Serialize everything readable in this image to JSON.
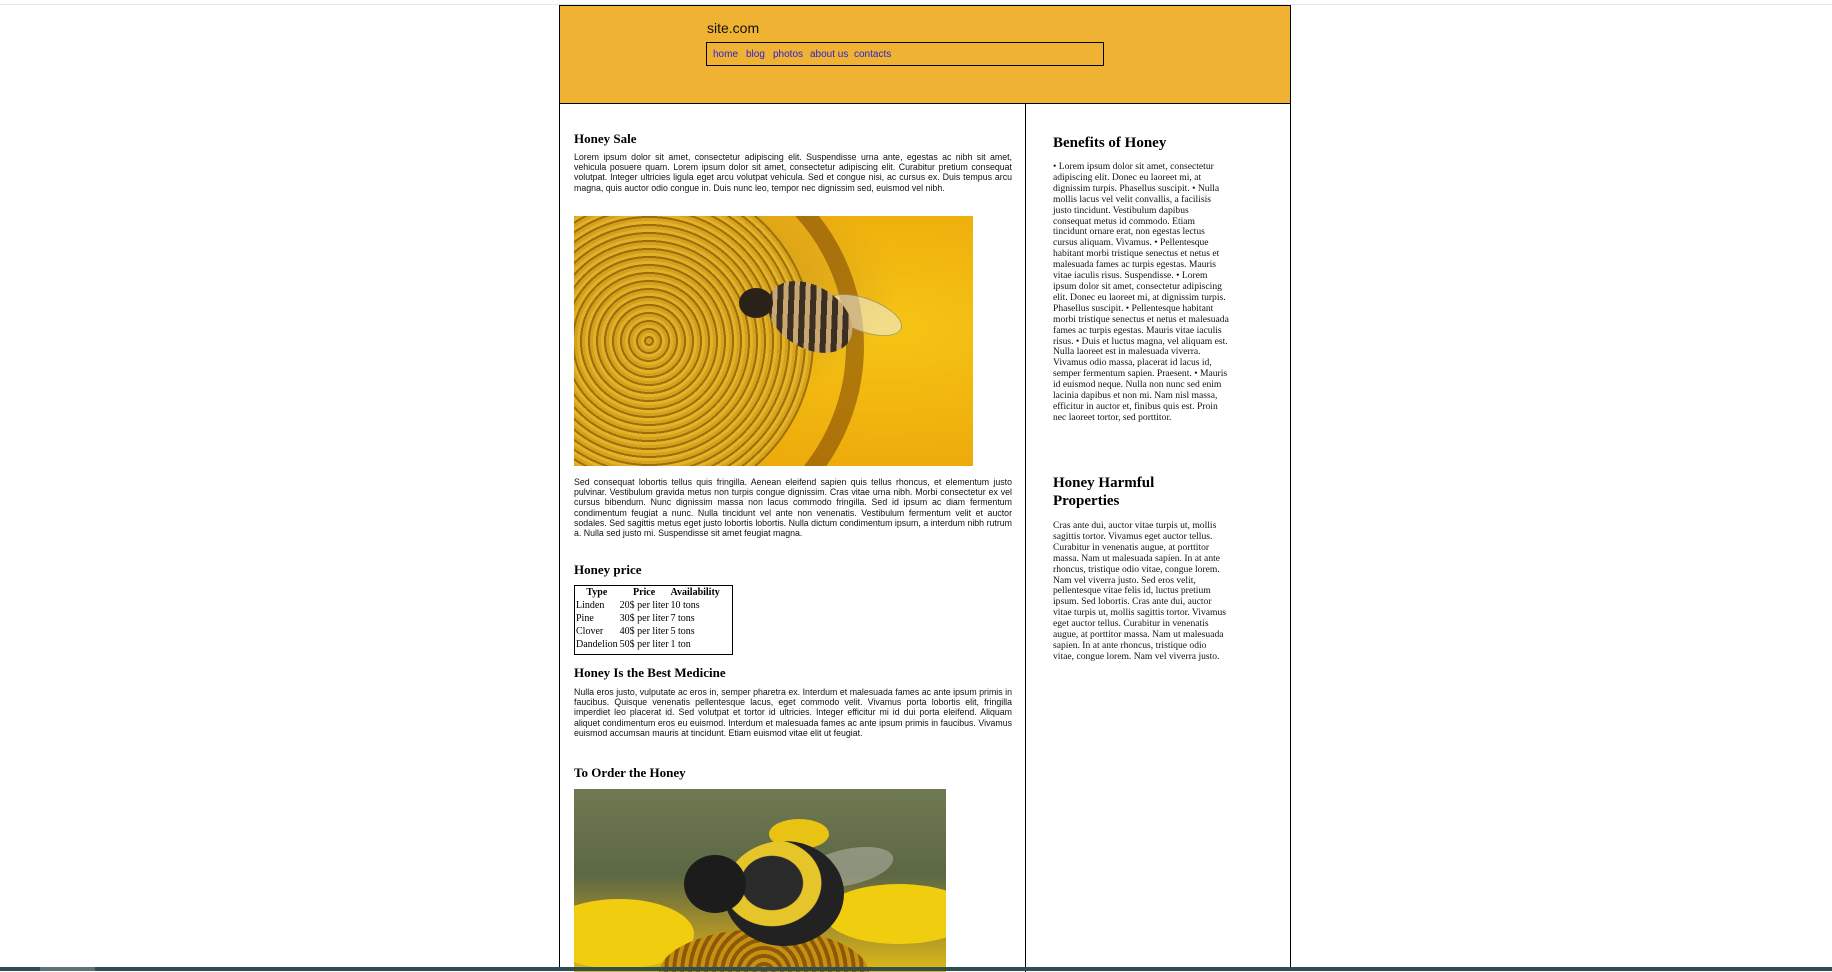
{
  "header": {
    "logo": "site.com",
    "nav": [
      "home",
      "blog",
      "photos",
      "about us",
      "contacts"
    ]
  },
  "main": {
    "honey_sale_title": "Honey Sale",
    "honey_sale_text": "Lorem ipsum dolor sit amet, consectetur adipiscing elit. Suspendisse urna ante, egestas ac nibh sit amet, vehicula posuere quam. Lorem ipsum dolor sit amet, consectetur adipiscing elit. Curabitur pretium consequat volutpat. Integer ultricies ligula eget arcu volutpat vehicula. Sed et congue nisi, ac cursus ex. Duis tempus arcu magna, quis auctor odio congue in. Duis nunc leo, tempor nec dignissim sed, euismod vel nibh.",
    "after_image_text": "Sed consequat lobortis tellus quis fringilla. Aenean eleifend sapien quis tellus rhoncus, et elementum justo pulvinar. Vestibulum gravida metus non turpis congue dignissim. Cras vitae urna nibh. Morbi consectetur ex vel cursus bibendum. Nunc dignissim massa non lacus commodo fringilla. Sed id ipsum ac diam fermentum condimentum feugiat a nunc. Nulla tincidunt vel ante non venenatis. Vestibulum fermentum velit et auctor sodales. Sed sagittis metus eget justo lobortis lobortis. Nulla dictum condimentum ipsum, a interdum nibh rutrum a. Nulla sed justo mi. Suspendisse sit amet feugiat magna.",
    "price_title": "Honey price",
    "price_table": {
      "headers": [
        "Type",
        "Price",
        "Availability"
      ],
      "rows": [
        [
          "Linden",
          "20$ per liter",
          "10 tons"
        ],
        [
          "Pine",
          "30$ per liter",
          "7 tons"
        ],
        [
          "Clover",
          "40$ per liter",
          "5 tons"
        ],
        [
          "Dandelion",
          "50$ per liter",
          "1 ton"
        ]
      ]
    },
    "medicine_title": "Honey Is the Best Medicine",
    "medicine_text": "Nulla eros justo, vulputate ac eros in, semper pharetra ex. Interdum et malesuada fames ac ante ipsum primis in faucibus. Quisque venenatis pellentesque lacus, eget commodo velit. Vivamus porta lobortis elit, fringilla imperdiet leo placerat id. Sed volutpat et tortor id ultricies. Integer efficitur mi id dui porta eleifend. Aliquam aliquet condimentum eros eu euismod. Interdum et malesuada fames ac ante ipsum primis in faucibus. Vivamus euismod accumsan mauris at tincidunt. Etiam euismod vitae elit ut feugiat.",
    "order_title": "To Order the Honey"
  },
  "aside": {
    "benefits_title": "Benefits of Honey",
    "benefits_text": "• Lorem ipsum dolor sit amet, consectetur adipiscing elit. Donec eu laoreet mi, at dignissim turpis. Phasellus suscipit. • Nulla mollis lacus vel velit convallis, a facilisis justo tincidunt. Vestibulum dapibus consequat metus id commodo. Etiam tincidunt ornare erat, non egestas lectus cursus aliquam. Vivamus. • Pellentesque habitant morbi tristique senectus et netus et malesuada fames ac turpis egestas. Mauris vitae iaculis risus. Suspendisse. • Lorem ipsum dolor sit amet, consectetur adipiscing elit. Donec eu laoreet mi, at dignissim turpis. Phasellus suscipit. • Pellentesque habitant morbi tristique senectus et netus et malesuada fames ac turpis egestas. Mauris vitae iaculis risus. • Duis et luctus magna, vel aliquam est. Nulla laoreet est in malesuada viverra. Vivamus odio massa, placerat id lacus id, semper fermentum sapien. Praesent. • Mauris id euismod neque. Nulla non nunc sed enim lacinia dapibus et non mi. Nam nisl massa, efficitur in auctor et, finibus quis est. Proin nec laoreet tortor, sed porttitor.",
    "harmful_title": "Honey Harmful Properties",
    "harmful_text": "Cras ante dui, auctor vitae turpis ut, mollis sagittis tortor. Vivamus eget auctor tellus. Curabitur in venenatis augue, at porttitor massa. Nam ut malesuada sapien. In at ante rhoncus, tristique odio vitae, congue lorem. Nam vel viverra justo. Sed eros velit, pellentesque vitae felis id, luctus pretium ipsum. Sed lobortis. Cras ante dui, auctor vitae turpis ut, mollis sagittis tortor. Vivamus eget auctor tellus. Curabitur in venenatis augue, at porttitor massa. Nam ut malesuada sapien. In at ante rhoncus, tristique odio vitae, congue lorem. Nam vel viverra justo."
  },
  "colors": {
    "header_bg": "#efb232",
    "nav_link": "#2a1fd6"
  },
  "icons": {
    "image_1": "sunflower-bee-image",
    "image_2": "bumblebee-sunflower-image"
  }
}
